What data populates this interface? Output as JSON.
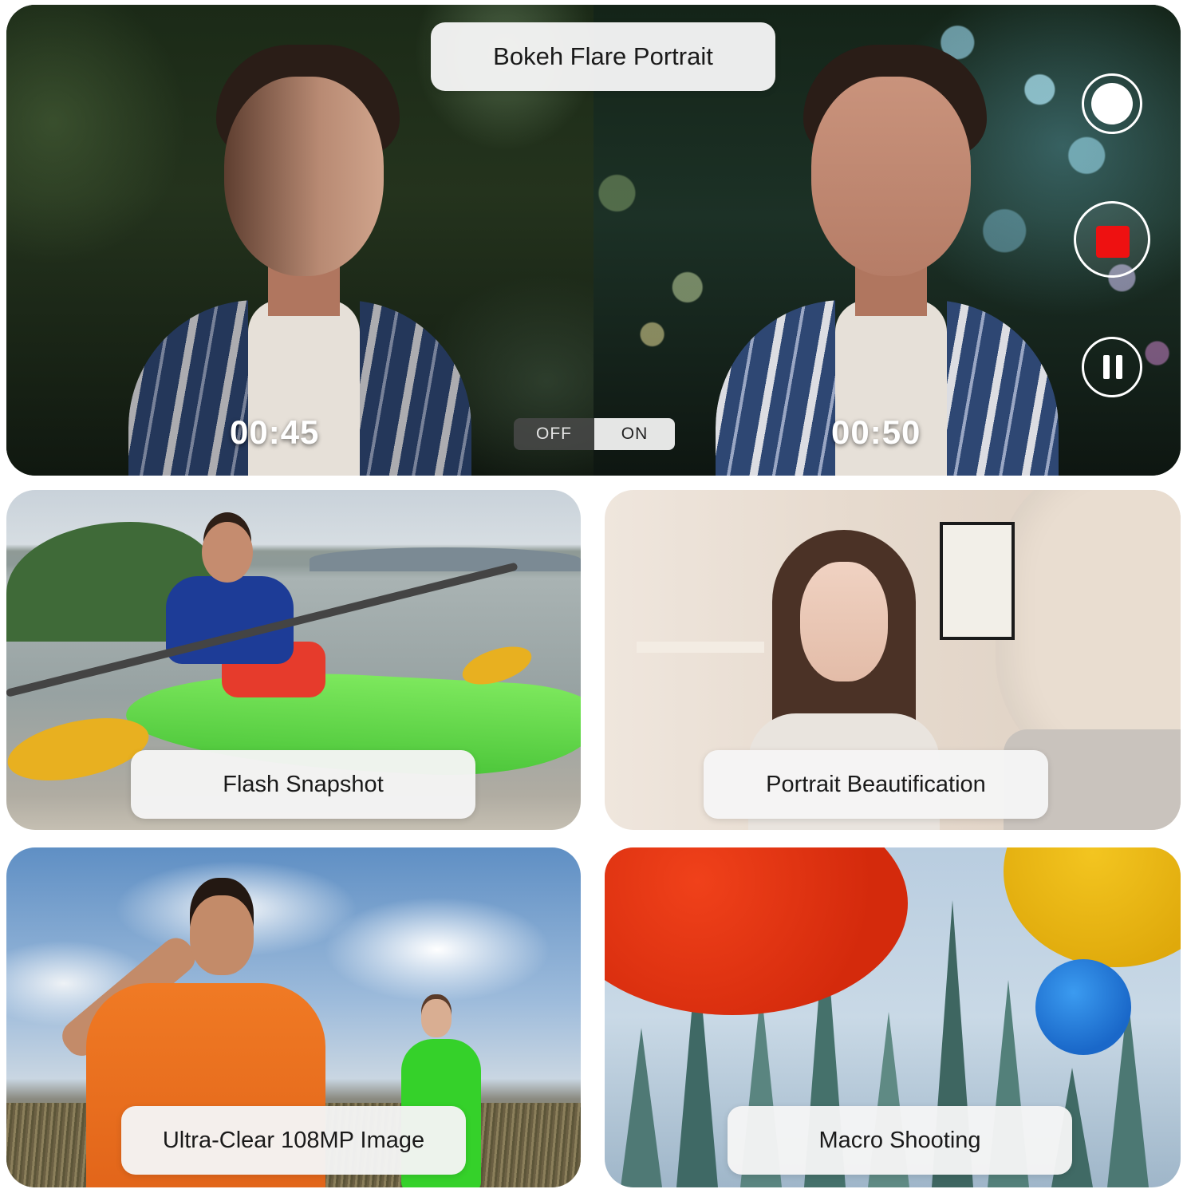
{
  "hero": {
    "title": "Bokeh Flare Portrait",
    "timer_left": "00:45",
    "timer_right": "00:50",
    "toggle": {
      "off_label": "OFF",
      "on_label": "ON",
      "selected": "ON"
    },
    "controls": {
      "record_color": "#ee1111"
    }
  },
  "tiles": {
    "flash": {
      "label": "Flash Snapshot"
    },
    "beauty": {
      "label": "Portrait Beautification"
    },
    "ultra": {
      "label": "Ultra-Clear 108MP Image"
    },
    "macro": {
      "label": "Macro Shooting"
    }
  }
}
